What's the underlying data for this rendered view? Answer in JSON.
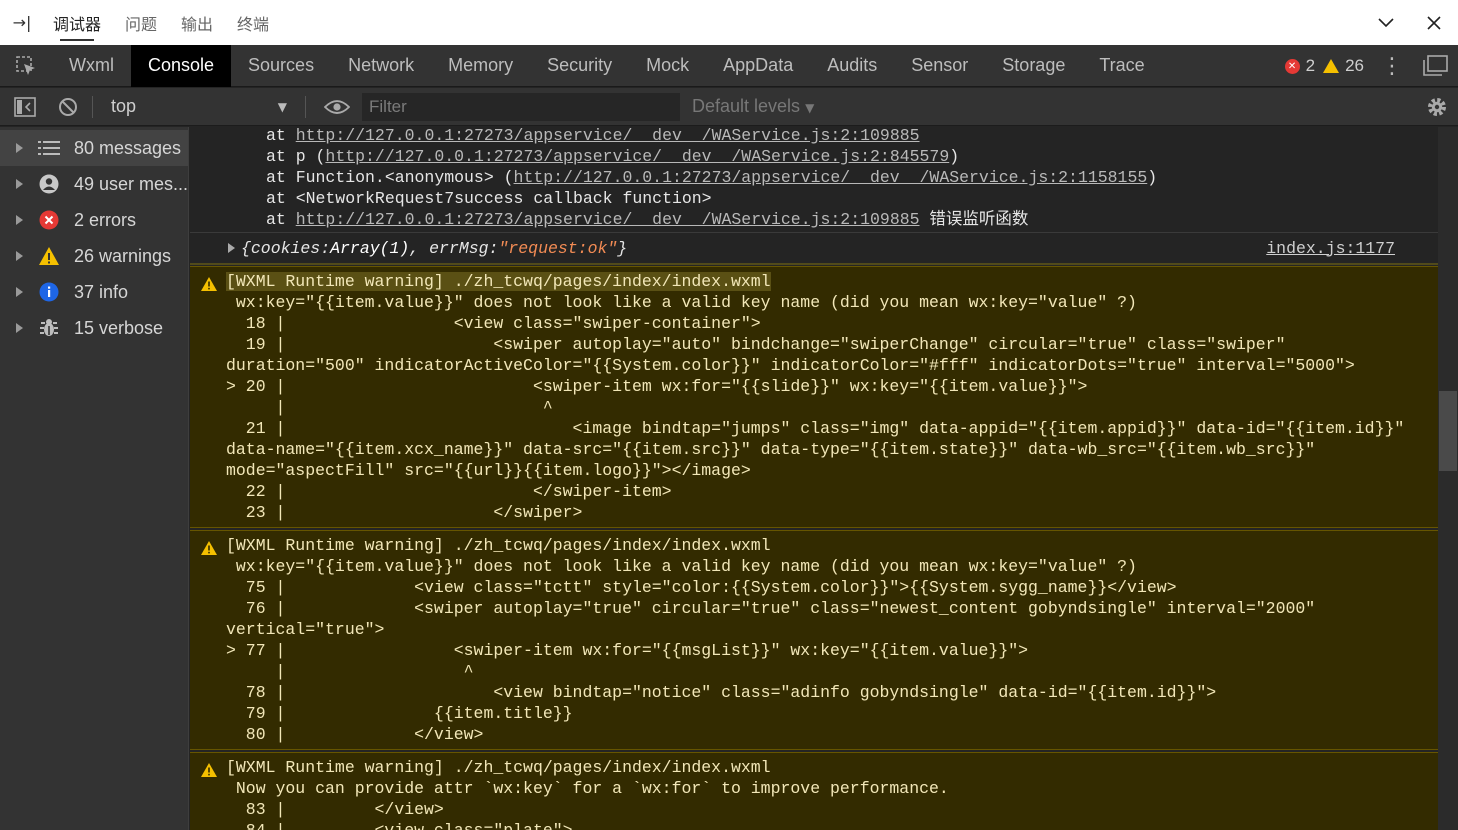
{
  "window_tabs": [
    "调试器",
    "问题",
    "输出",
    "终端"
  ],
  "devtools_tabs": [
    "Wxml",
    "Console",
    "Sources",
    "Network",
    "Memory",
    "Security",
    "Mock",
    "AppData",
    "Audits",
    "Sensor",
    "Storage",
    "Trace"
  ],
  "counts": {
    "errors": "2",
    "warnings": "26"
  },
  "toolbar": {
    "context": "top",
    "filter_placeholder": "Filter",
    "levels": "Default levels"
  },
  "sidebar": [
    {
      "label": "80 messages",
      "icon": "list-icon"
    },
    {
      "label": "49 user mes...",
      "icon": "user-icon"
    },
    {
      "label": "2 errors",
      "icon": "error-icon"
    },
    {
      "label": "26 warnings",
      "icon": "warning-icon"
    },
    {
      "label": "37 info",
      "icon": "info-icon"
    },
    {
      "label": "15 verbose",
      "icon": "bug-icon"
    }
  ],
  "trace": [
    {
      "pre": "at ",
      "link": "http://127.0.0.1:27273/appservice/__dev__/WAService.js:2:109885",
      "post": ""
    },
    {
      "pre": "at p (",
      "link": "http://127.0.0.1:27273/appservice/__dev__/WAService.js:2:845579",
      "post": ")"
    },
    {
      "pre": "at Function.<anonymous> (",
      "link": "http://127.0.0.1:27273/appservice/__dev__/WAService.js:2:1158155",
      "post": ")"
    },
    {
      "pre": "at <NetworkRequest7success callback function>",
      "link": "",
      "post": ""
    },
    {
      "pre": "at ",
      "link": "http://127.0.0.1:27273/appservice/__dev__/WAService.js:2:109885",
      "post": " 错误监听函数"
    }
  ],
  "object_line": {
    "p1": "{cookies: ",
    "p2": "Array(1)",
    "p3": ", errMsg: ",
    "str": "\"request:ok\"",
    "p4": "}",
    "source": "index.js:1177"
  },
  "warnings": [
    {
      "title": "[WXML Runtime warning] ./zh_tcwq/pages/index/index.wxml",
      "lines": [
        " wx:key=\"{{item.value}}\" does not look like a valid key name (did you mean wx:key=\"value\" ?)",
        "  18 |                 <view class=\"swiper-container\">",
        "  19 |                     <swiper autoplay=\"auto\" bindchange=\"swiperChange\" circular=\"true\" class=\"swiper\"",
        "duration=\"500\" indicatorActiveColor=\"{{System.color}}\" indicatorColor=\"#fff\" indicatorDots=\"true\" interval=\"5000\">",
        "> 20 |                         <swiper-item wx:for=\"{{slide}}\" wx:key=\"{{item.value}}\">",
        "     |                          ^",
        "  21 |                             <image bindtap=\"jumps\" class=\"img\" data-appid=\"{{item.appid}}\" data-id=\"{{item.id}}\"",
        "data-name=\"{{item.xcx_name}}\" data-src=\"{{item.src}}\" data-type=\"{{item.state}}\" data-wb_src=\"{{item.wb_src}}\"",
        "mode=\"aspectFill\" src=\"{{url}}{{item.logo}}\"></image>",
        "  22 |                         </swiper-item>",
        "  23 |                     </swiper>"
      ]
    },
    {
      "title": "[WXML Runtime warning] ./zh_tcwq/pages/index/index.wxml",
      "lines": [
        " wx:key=\"{{item.value}}\" does not look like a valid key name (did you mean wx:key=\"value\" ?)",
        "  75 |             <view class=\"tctt\" style=\"color:{{System.color}}\">{{System.sygg_name}}</view>",
        "  76 |             <swiper autoplay=\"true\" circular=\"true\" class=\"newest_content gobyndsingle\" interval=\"2000\"",
        "vertical=\"true\">",
        "> 77 |                 <swiper-item wx:for=\"{{msgList}}\" wx:key=\"{{item.value}}\">",
        "     |                  ^",
        "  78 |                     <view bindtap=\"notice\" class=\"adinfo gobyndsingle\" data-id=\"{{item.id}}\">",
        "  79 |               {{item.title}}",
        "  80 |             </view>"
      ]
    },
    {
      "title": "[WXML Runtime warning] ./zh_tcwq/pages/index/index.wxml",
      "lines": [
        " Now you can provide attr `wx:key` for a `wx:for` to improve performance.",
        "  83 |         </view>",
        "  84 |         <view class=\"plate\">"
      ]
    }
  ]
}
